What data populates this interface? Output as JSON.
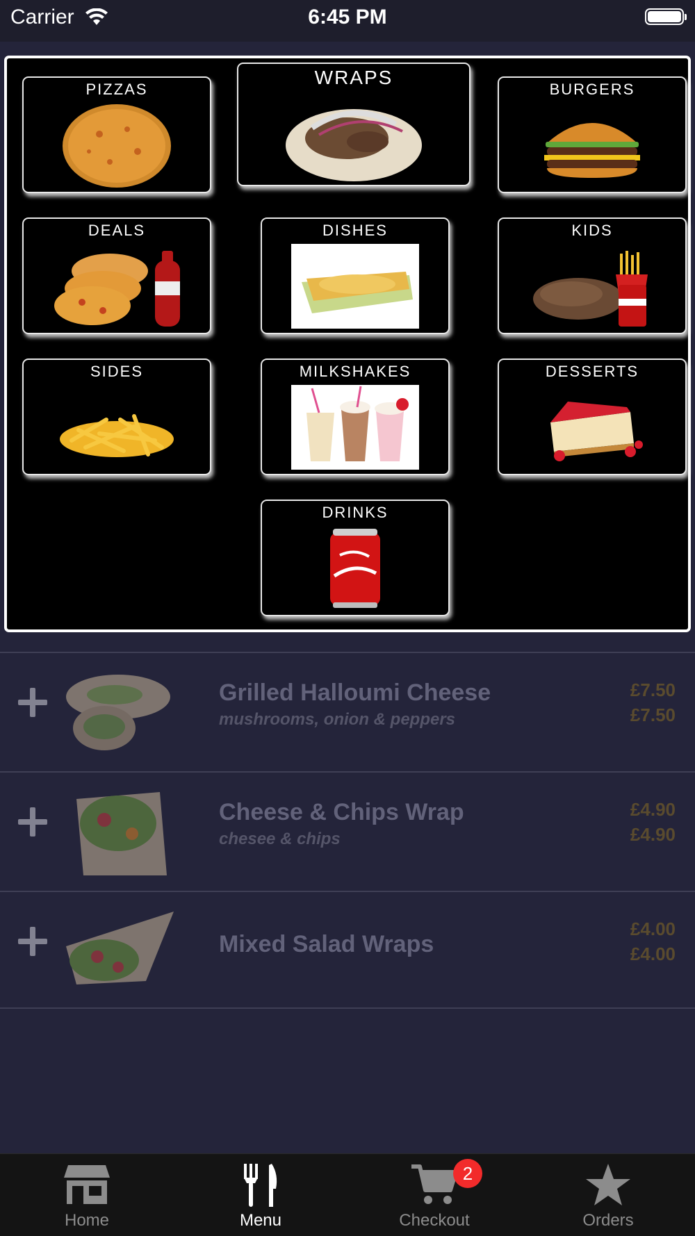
{
  "status_bar": {
    "carrier": "Carrier",
    "time": "6:45 PM"
  },
  "categories": [
    {
      "label": "PIZZAS",
      "icon": "pizza-icon"
    },
    {
      "label": "WRAPS",
      "icon": "wrap-icon"
    },
    {
      "label": "BURGERS",
      "icon": "burger-icon"
    },
    {
      "label": "DEALS",
      "icon": "pizza-cola-deal-icon"
    },
    {
      "label": "DISHES",
      "icon": "baked-dish-icon"
    },
    {
      "label": "KIDS",
      "icon": "kids-meal-icon"
    },
    {
      "label": "SIDES",
      "icon": "fries-icon"
    },
    {
      "label": "MILKSHAKES",
      "icon": "milkshakes-icon"
    },
    {
      "label": "DESSERTS",
      "icon": "cheesecake-icon"
    },
    {
      "label": "DRINKS",
      "icon": "cola-can-icon"
    }
  ],
  "menu_items": [
    {
      "name": "Grilled Halloumi Cheese",
      "description": "mushrooms, onion & peppers",
      "price": "£7.50",
      "price_secondary": "£7.50"
    },
    {
      "name": "Cheese & Chips Wrap",
      "description": "chesee & chips",
      "price": "£4.90",
      "price_secondary": "£4.90"
    },
    {
      "name": "Mixed Salad Wraps",
      "description": "",
      "price": "£4.00",
      "price_secondary": "£4.00"
    }
  ],
  "tab_bar": {
    "tabs": [
      {
        "label": "Home",
        "icon": "store-icon",
        "active": false
      },
      {
        "label": "Menu",
        "icon": "fork-knife-icon",
        "active": true
      },
      {
        "label": "Checkout",
        "icon": "cart-icon",
        "active": false
      },
      {
        "label": "Orders",
        "icon": "star-icon",
        "active": false
      }
    ],
    "checkout_badge": "2"
  },
  "colors": {
    "accent_badge": "#f22b2b",
    "panel_border": "#ffffff",
    "background": "#24243a"
  }
}
